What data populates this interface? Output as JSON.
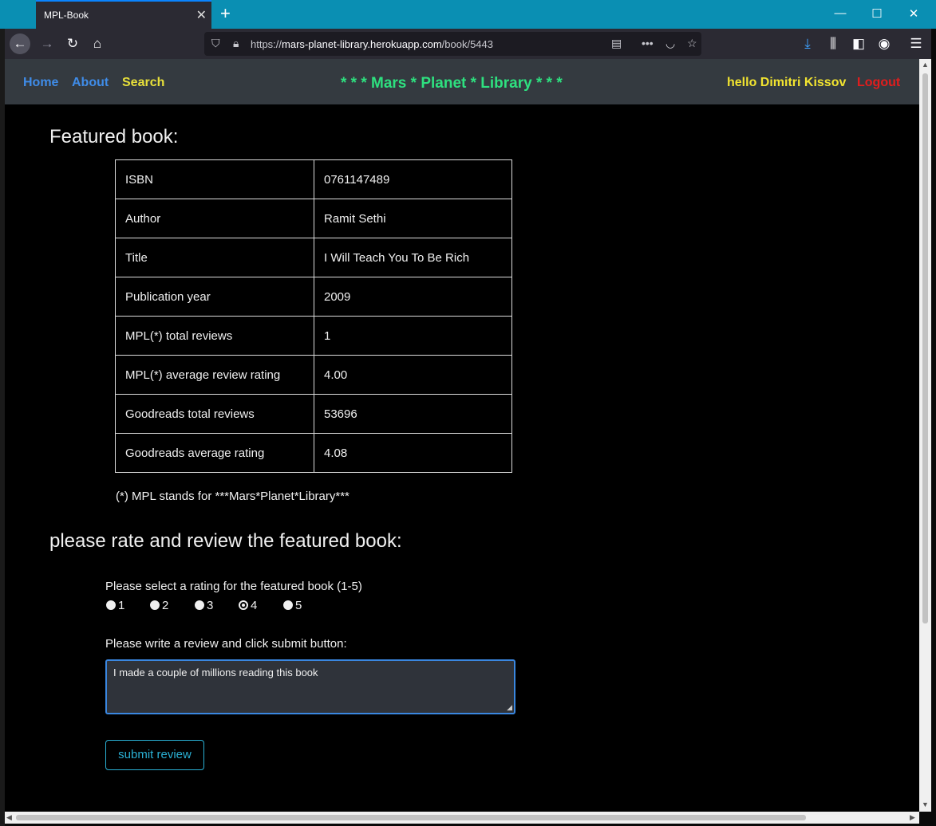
{
  "browser": {
    "tab_title": "MPL-Book",
    "url_prefix": "https://",
    "url_host": "mars-planet-library.herokuapp.com",
    "url_path": "/book/5443"
  },
  "site_nav": {
    "home": "Home",
    "about": "About",
    "search": "Search",
    "brand": "* * * Mars * Planet * Library * * *",
    "greeting": "hello Dimitri Kissov",
    "logout": "Logout"
  },
  "featured": {
    "heading": "Featured book:",
    "rows": [
      {
        "key": "ISBN",
        "value": "0761147489"
      },
      {
        "key": "Author",
        "value": "Ramit Sethi"
      },
      {
        "key": "Title",
        "value": "I Will Teach You To Be Rich"
      },
      {
        "key": "Publication year",
        "value": "2009"
      },
      {
        "key": "MPL(*) total reviews",
        "value": "1"
      },
      {
        "key": "MPL(*) average review rating",
        "value": "4.00"
      },
      {
        "key": "Goodreads total reviews",
        "value": "53696"
      },
      {
        "key": "Goodreads average rating",
        "value": "4.08"
      }
    ],
    "footnote": "(*) MPL stands for ***Mars*Planet*Library***"
  },
  "review_form": {
    "heading": "please rate and review the featured book:",
    "rating_label": "Please select a rating for the featured book (1-5)",
    "options": [
      "1",
      "2",
      "3",
      "4",
      "5"
    ],
    "selected": "4",
    "review_label": "Please write a review and click submit button:",
    "review_text": "I made a couple of millions reading this book",
    "submit_label": "submit review"
  },
  "colors": {
    "brand": "#2ee07f",
    "nav_link": "#3f8ce8",
    "search_link": "#e8e03a",
    "greeting": "#f2e430",
    "logout": "#e21d1d",
    "submit": "#2ab0d4"
  }
}
